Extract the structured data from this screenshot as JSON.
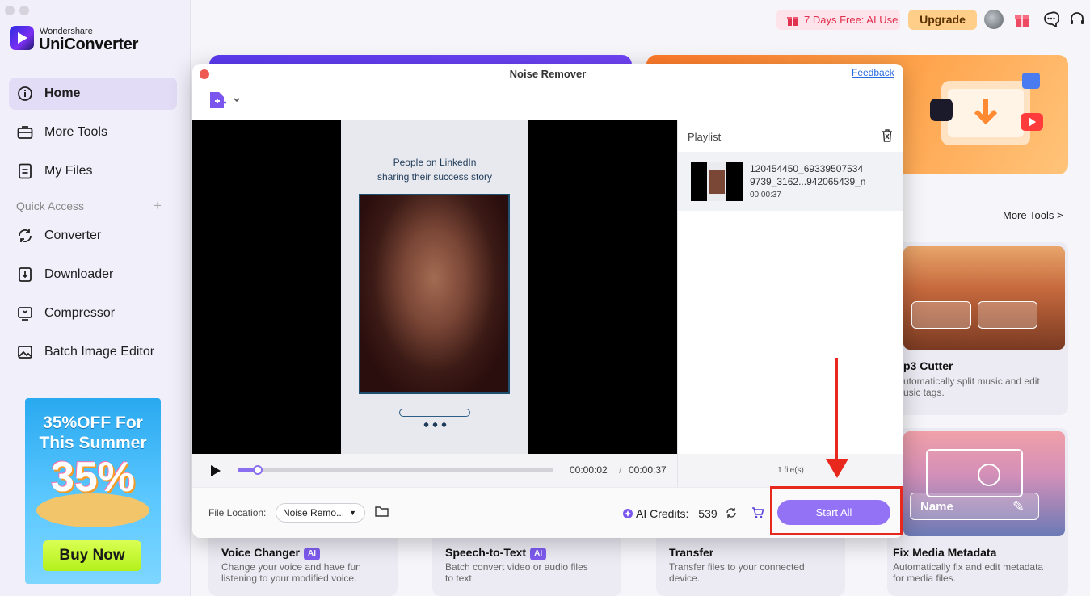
{
  "app": {
    "brand_small": "Wondershare",
    "brand_name": "UniConverter"
  },
  "sidebar": {
    "nav": [
      {
        "label": "Home",
        "icon": "home-icon"
      },
      {
        "label": "More Tools",
        "icon": "toolbox-icon"
      },
      {
        "label": "My Files",
        "icon": "file-icon"
      }
    ],
    "quick_access_label": "Quick Access",
    "quick_access_add": "+",
    "quick": [
      {
        "label": "Converter",
        "icon": "converter-icon"
      },
      {
        "label": "Downloader",
        "icon": "downloader-icon"
      },
      {
        "label": "Compressor",
        "icon": "compressor-icon"
      },
      {
        "label": "Batch Image Editor",
        "icon": "image-editor-icon"
      }
    ],
    "promo": {
      "line1": "35%OFF For",
      "line2": "This Summer",
      "big": "35%",
      "button": "Buy Now"
    }
  },
  "header": {
    "free_trial": "7 Days Free: AI Use",
    "upgrade": "Upgrade"
  },
  "main": {
    "more_tools_link": "More Tools >",
    "mp3_cutter": {
      "title": "p3 Cutter",
      "desc1": "utomatically split music and edit",
      "desc2": "usic tags."
    },
    "overlay_name": "Name",
    "cards": [
      {
        "title": "Voice Changer",
        "ai": "AI",
        "desc1": "Change your voice and have fun",
        "desc2": "listening to your modified voice."
      },
      {
        "title": "Speech-to-Text",
        "ai": "AI",
        "desc1": "Batch convert video or audio files",
        "desc2": "to text."
      },
      {
        "title": "Transfer",
        "desc1": "Transfer files to your connected",
        "desc2": "device."
      },
      {
        "title": "Fix Media Metadata",
        "desc1": "Automatically fix and edit metadata",
        "desc2": "for media files."
      }
    ]
  },
  "dialog": {
    "title": "Noise Remover",
    "feedback": "Feedback",
    "video_caption_line1": "People on LinkedIn",
    "video_caption_line2": "sharing their success story",
    "playlist_label": "Playlist",
    "playlist_item": {
      "name_line1": "120454450_69339507534",
      "name_line2": "9739_3162...942065439_n",
      "duration": "00:00:37"
    },
    "current_time": "00:00:02",
    "time_separator": "/",
    "total_time": "00:00:37",
    "progress": 0.065,
    "file_count": "1 file(s)",
    "file_location_label": "File Location:",
    "file_location_value": "Noise Remo...",
    "ai_credits_label": "AI Credits:",
    "ai_credits_value": "539",
    "start_button": "Start All"
  },
  "colors": {
    "accent": "#9372f5",
    "annotation": "#e8281c",
    "upgrade": "#ffcf8a"
  }
}
